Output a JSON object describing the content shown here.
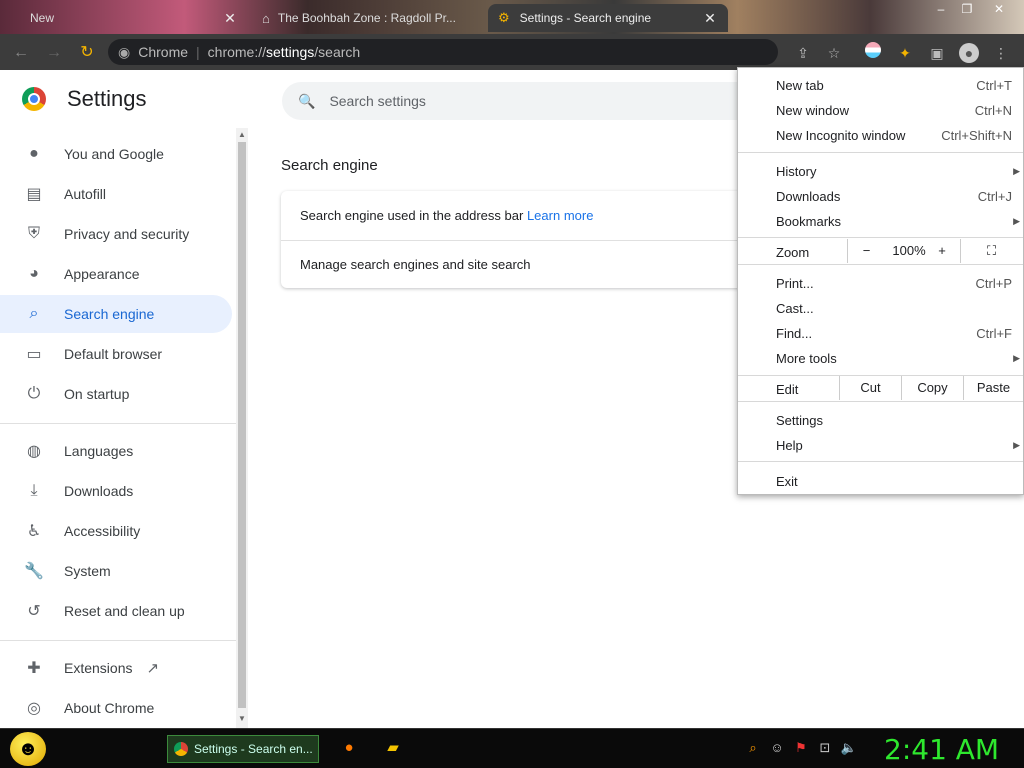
{
  "tabs": [
    {
      "title": "New",
      "active": false
    },
    {
      "title": "The Boohbah Zone : Ragdoll Pr...",
      "active": false
    },
    {
      "title": "Settings - Search engine",
      "active": true
    }
  ],
  "toolbar": {
    "omnibox_origin": "Chrome",
    "url_scheme": "chrome://",
    "url_host": "settings",
    "url_path": "/search"
  },
  "settings": {
    "title": "Settings",
    "search_placeholder": "Search settings",
    "nav": [
      {
        "label": "You and Google",
        "icon": "person-icon"
      },
      {
        "label": "Autofill",
        "icon": "clipboard-icon"
      },
      {
        "label": "Privacy and security",
        "icon": "shield-icon"
      },
      {
        "label": "Appearance",
        "icon": "palette-icon"
      },
      {
        "label": "Search engine",
        "icon": "search-icon",
        "selected": true
      },
      {
        "label": "Default browser",
        "icon": "browser-icon"
      },
      {
        "label": "On startup",
        "icon": "power-icon"
      },
      {
        "label": "Languages",
        "icon": "globe-icon"
      },
      {
        "label": "Downloads",
        "icon": "download-icon"
      },
      {
        "label": "Accessibility",
        "icon": "accessibility-icon"
      },
      {
        "label": "System",
        "icon": "wrench-icon"
      },
      {
        "label": "Reset and clean up",
        "icon": "history-icon"
      },
      {
        "label": "Extensions",
        "icon": "puzzle-icon"
      },
      {
        "label": "About Chrome",
        "icon": "chrome-icon"
      }
    ],
    "section_title": "Search engine",
    "row1_text": "Search engine used in the address bar",
    "row1_link": "Learn more",
    "row2_text": "Manage search engines and site search"
  },
  "menu": {
    "new_tab": "New tab",
    "new_tab_sc": "Ctrl+T",
    "new_window": "New window",
    "new_window_sc": "Ctrl+N",
    "new_incognito": "New Incognito window",
    "new_incognito_sc": "Ctrl+Shift+N",
    "history": "History",
    "downloads": "Downloads",
    "downloads_sc": "Ctrl+J",
    "bookmarks": "Bookmarks",
    "zoom": "Zoom",
    "zoom_minus": "−",
    "zoom_value": "100%",
    "zoom_plus": "+",
    "print": "Print...",
    "print_sc": "Ctrl+P",
    "cast": "Cast...",
    "find": "Find...",
    "find_sc": "Ctrl+F",
    "more_tools": "More tools",
    "edit": "Edit",
    "cut": "Cut",
    "copy": "Copy",
    "paste": "Paste",
    "settings": "Settings",
    "help": "Help",
    "exit": "Exit"
  },
  "taskbar": {
    "chrome_task": "Settings - Search en...",
    "clock": "2:41 AM"
  },
  "colors": {
    "accent": "#1a73e8",
    "selected_bg": "#e8f0fe",
    "clock": "#2ee82e"
  }
}
